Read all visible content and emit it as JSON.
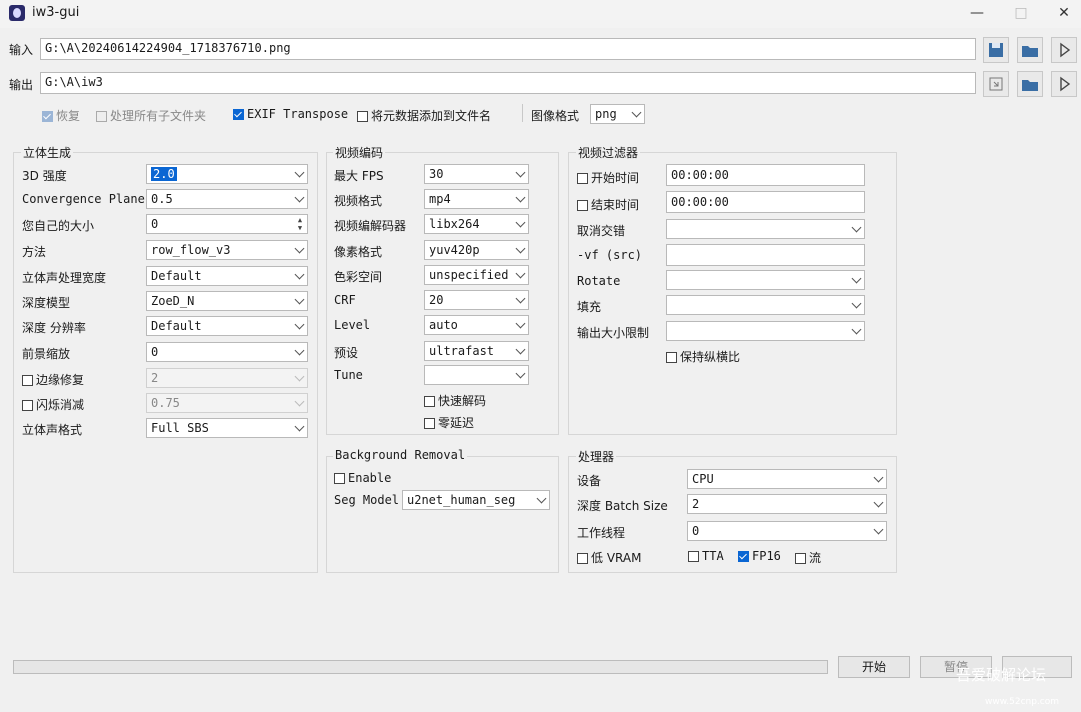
{
  "window": {
    "title": "iw3-gui"
  },
  "io": {
    "input_label": "输入",
    "input_value": "G:\\A\\20240614224904_1718376710.png",
    "output_label": "输出",
    "output_value": "G:\\A\\iw3"
  },
  "options": {
    "resume": "恢复",
    "recursive": "处理所有子文件夹",
    "exif": "EXIF Transpose",
    "metadata": "将元数据添加到文件名",
    "image_format_label": "图像格式",
    "image_format_value": "png"
  },
  "stereo": {
    "title": "立体生成",
    "rows": [
      {
        "label": "3D 强度",
        "value": "2.0"
      },
      {
        "label": "Convergence Plane",
        "value": "0.5"
      },
      {
        "label": "您自己的大小",
        "value": "0"
      },
      {
        "label": "方法",
        "value": "row_flow_v3"
      },
      {
        "label": "立体声处理宽度",
        "value": "Default"
      },
      {
        "label": "深度模型",
        "value": "ZoeD_N"
      },
      {
        "label": "深度 分辨率",
        "value": "Default"
      },
      {
        "label": "前景缩放",
        "value": "0"
      },
      {
        "label": "边缘修复",
        "value": "2"
      },
      {
        "label": "闪烁消减",
        "value": "0.75"
      },
      {
        "label": "立体声格式",
        "value": "Full SBS"
      }
    ]
  },
  "video_encoding": {
    "title": "视频编码",
    "rows": [
      {
        "label": "最大 FPS",
        "value": "30"
      },
      {
        "label": "视频格式",
        "value": "mp4"
      },
      {
        "label": "视频编解码器",
        "value": "libx264"
      },
      {
        "label": "像素格式",
        "value": "yuv420p"
      },
      {
        "label": "色彩空间",
        "value": "unspecified"
      },
      {
        "label": "CRF",
        "value": "20"
      },
      {
        "label": "Level",
        "value": "auto"
      },
      {
        "label": "预设",
        "value": "ultrafast"
      },
      {
        "label": "Tune",
        "value": ""
      }
    ],
    "fast_decode": "快速解码",
    "zero_latency": "零延迟"
  },
  "bg_removal": {
    "title": "Background Removal",
    "enable": "Enable",
    "seg_label": "Seg Model",
    "seg_value": "u2net_human_seg"
  },
  "video_filter": {
    "title": "视频过滤器",
    "start_label": "开始时间",
    "start_value": "00:00:00",
    "end_label": "结束时间",
    "end_value": "00:00:00",
    "deinterlace": "取消交错",
    "vf": "-vf (src)",
    "rotate": "Rotate",
    "pad": "填充",
    "max_size": "输出大小限制",
    "keep_aspect": "保持纵横比"
  },
  "processor": {
    "title": "处理器",
    "device_label": "设备",
    "device_value": "CPU",
    "batch_label": "深度 Batch Size",
    "batch_value": "2",
    "threads_label": "工作线程",
    "threads_value": "0",
    "low_vram": "低 VRAM",
    "tta": "TTA",
    "fp16": "FP16",
    "stream": "流"
  },
  "footer": {
    "start": "开始",
    "pause": "暂停",
    "watermark": "吾爱破解论坛",
    "watermark_url": "www.52cnp.com"
  },
  "colors": {
    "accent": "#0a66d3",
    "background": "#f0f0f0"
  }
}
